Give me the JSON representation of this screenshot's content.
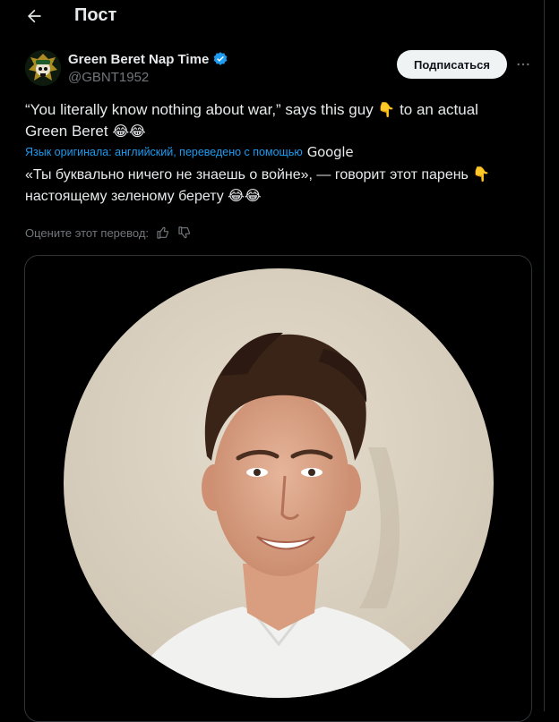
{
  "header": {
    "title": "Пост",
    "back_icon": "arrow-left-icon"
  },
  "author": {
    "name": "Green Beret Nap Time",
    "handle": "@GBNT1952",
    "verified": true,
    "avatar_icon": "skull-beret-avatar"
  },
  "actions": {
    "subscribe_label": "Подписаться",
    "more_icon": "more-horizontal-icon"
  },
  "tweet": {
    "text_line1": "“You literally know nothing about war,” says this guy ",
    "point_down_emoji": "👇",
    "text_line1_end": " to an actual",
    "text_line2": "Green Beret ",
    "laugh_emojis": "😂😂",
    "translation_note": "Язык оригинала: английский, переведено с помощью",
    "translation_provider": "Google",
    "translated_line1": "«Ты буквально ничего не знаешь о войне», — говорит этот парень ",
    "translated_line2": "настоящему зеленому берету ",
    "rate_prompt": "Оцените этот перевод:",
    "rate_up_icon": "thumbs-up-icon",
    "rate_down_icon": "thumbs-down-icon"
  },
  "media": {
    "type": "image",
    "description_icon": "portrait-photo"
  },
  "colors": {
    "background": "#000000",
    "text": "#e7e9ea",
    "muted": "#71767b",
    "accent": "#1d9bf0",
    "border": "#2f3336"
  }
}
